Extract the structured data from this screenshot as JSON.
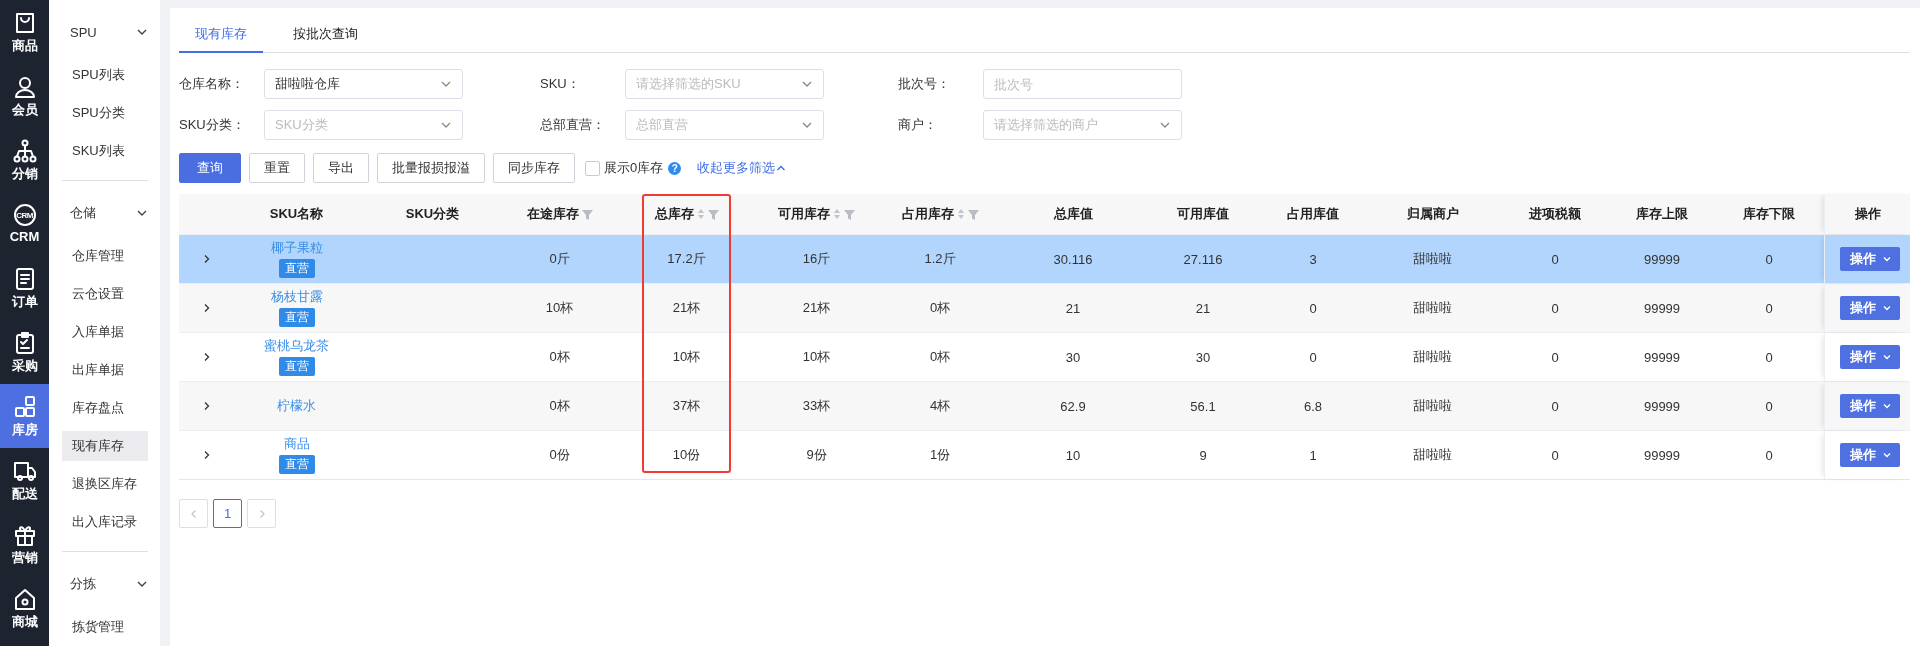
{
  "nav": [
    {
      "label": "商品",
      "selected": false
    },
    {
      "label": "会员",
      "selected": false
    },
    {
      "label": "分销",
      "selected": false
    },
    {
      "label": "CRM",
      "selected": false,
      "icon_text": "CRM"
    },
    {
      "label": "订单",
      "selected": false
    },
    {
      "label": "采购",
      "selected": false
    },
    {
      "label": "库房",
      "selected": true
    },
    {
      "label": "配送",
      "selected": false
    },
    {
      "label": "营销",
      "selected": false
    },
    {
      "label": "商城",
      "selected": false
    }
  ],
  "submenu": [
    {
      "title": "SPU",
      "expanded": true,
      "items": [
        {
          "label": "SPU列表",
          "selected": false
        },
        {
          "label": "SPU分类",
          "selected": false
        },
        {
          "label": "SKU列表",
          "selected": false
        }
      ]
    },
    {
      "title": "仓储",
      "expanded": true,
      "items": [
        {
          "label": "仓库管理",
          "selected": false
        },
        {
          "label": "云仓设置",
          "selected": false
        },
        {
          "label": "入库单据",
          "selected": false
        },
        {
          "label": "出库单据",
          "selected": false
        },
        {
          "label": "库存盘点",
          "selected": false
        },
        {
          "label": "现有库存",
          "selected": true
        },
        {
          "label": "退换区库存",
          "selected": false
        },
        {
          "label": "出入库记录",
          "selected": false
        }
      ]
    },
    {
      "title": "分拣",
      "expanded": true,
      "items": [
        {
          "label": "拣货管理",
          "selected": false
        }
      ]
    }
  ],
  "tabs": [
    {
      "label": "现有库存",
      "selected": true
    },
    {
      "label": "按批次查询",
      "selected": false
    }
  ],
  "filters": [
    {
      "label": "仓库名称：",
      "kind": "select",
      "value": "甜啦啦仓库"
    },
    {
      "label": "SKU：",
      "kind": "select",
      "placeholder": "请选择筛选的SKU"
    },
    {
      "label": "批次号：",
      "kind": "input",
      "placeholder": "批次号"
    },
    {
      "label": "SKU分类：",
      "kind": "select",
      "placeholder": "SKU分类"
    },
    {
      "label": "总部直营：",
      "kind": "select",
      "placeholder": "总部直营"
    },
    {
      "label": "商户：",
      "kind": "select",
      "placeholder": "请选择筛选的商户"
    }
  ],
  "actions": [
    {
      "label": "查询",
      "primary": true
    },
    {
      "label": "重置",
      "primary": false
    },
    {
      "label": "导出",
      "primary": false
    },
    {
      "label": "批量报损报溢",
      "primary": false
    },
    {
      "label": "同步库存",
      "primary": false
    }
  ],
  "show_zero": {
    "label": "展示0库存",
    "checked": false,
    "help": "?"
  },
  "collapse_link": "收起更多筛选",
  "table": {
    "columns": [
      {
        "label": "SKU名称",
        "kind": "name"
      },
      {
        "label": "SKU分类",
        "kind": "category"
      },
      {
        "label": "在途库存",
        "kind": "value",
        "sortable": false,
        "filterable": true
      },
      {
        "label": "总库存",
        "kind": "value",
        "sortable": true,
        "filterable": true,
        "highlighted": true
      },
      {
        "label": "可用库存",
        "kind": "value",
        "sortable": true,
        "filterable": true
      },
      {
        "label": "占用库存",
        "kind": "value",
        "sortable": true,
        "filterable": true
      },
      {
        "label": "总库值",
        "kind": "value"
      },
      {
        "label": "可用库值",
        "kind": "value"
      },
      {
        "label": "占用库值",
        "kind": "value"
      },
      {
        "label": "归属商户",
        "kind": "value"
      },
      {
        "label": "进项税额",
        "kind": "value"
      },
      {
        "label": "库存上限",
        "kind": "value"
      },
      {
        "label": "库存下限",
        "kind": "value"
      },
      {
        "label": "操作",
        "kind": "action"
      }
    ],
    "rows": [
      {
        "expanded": false,
        "selected": true,
        "name": "椰子果粒",
        "tag": "直营",
        "values": [
          "0斤",
          "17.2斤",
          "16斤",
          "1.2斤",
          "30.116",
          "27.116",
          "3",
          "甜啦啦",
          "0",
          "99999",
          "0"
        ],
        "action": "操作"
      },
      {
        "expanded": false,
        "selected": false,
        "name": "杨枝甘露",
        "tag": "直营",
        "values": [
          "10杯",
          "21杯",
          "21杯",
          "0杯",
          "21",
          "21",
          "0",
          "甜啦啦",
          "0",
          "99999",
          "0"
        ],
        "action": "操作"
      },
      {
        "expanded": false,
        "selected": false,
        "name": "蜜桃乌龙茶",
        "tag": "直营",
        "values": [
          "0杯",
          "10杯",
          "10杯",
          "0杯",
          "30",
          "30",
          "0",
          "甜啦啦",
          "0",
          "99999",
          "0"
        ],
        "action": "操作"
      },
      {
        "expanded": false,
        "selected": false,
        "name": "柠檬水",
        "values": [
          "0杯",
          "37杯",
          "33杯",
          "4杯",
          "62.9",
          "56.1",
          "6.8",
          "甜啦啦",
          "0",
          "99999",
          "0"
        ],
        "action": "操作"
      },
      {
        "expanded": false,
        "selected": false,
        "name": "商品",
        "tag": "直营",
        "values": [
          "0份",
          "10份",
          "9份",
          "1份",
          "10",
          "9",
          "1",
          "甜啦啦",
          "0",
          "99999",
          "0"
        ],
        "action": "操作"
      }
    ]
  },
  "pagination": {
    "pages": [
      {
        "label": "1",
        "selected": true
      }
    ]
  }
}
